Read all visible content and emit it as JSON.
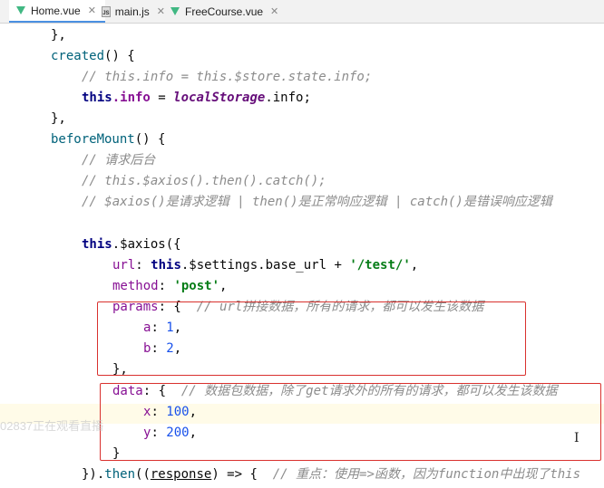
{
  "tabs": [
    {
      "name": "Home.vue",
      "icon": "vue-icon",
      "active": true
    },
    {
      "name": "main.js",
      "icon": "js-file-icon",
      "active": false
    },
    {
      "name": "FreeCourse.vue",
      "icon": "vue-icon",
      "active": false
    }
  ],
  "code": {
    "l1": "},",
    "l2_fn": "created",
    "l2_rest": "() {",
    "l3": "// this.info = this.$store.state.info;",
    "l4_this": "this",
    "l4_prop": ".info",
    "l4_eq": " = ",
    "l4_ls": "localStorage",
    "l4_rest": ".info;",
    "l5": "},",
    "l6_fn": "beforeMount",
    "l6_rest": "() {",
    "l7": "// 请求后台",
    "l8": "// this.$axios().then().catch();",
    "l9": "// $axios()是请求逻辑 | then()是正常响应逻辑 | catch()是错误响应逻辑",
    "l11_this": "this",
    "l11_rest": ".$axios({",
    "l12_key": "url",
    "l12_colon": ": ",
    "l12_this": "this",
    "l12_mid": ".$settings.base_url + ",
    "l12_str": "'/test/'",
    "l12_end": ",",
    "l13_key": "method",
    "l13_colon": ": ",
    "l13_str": "'post'",
    "l13_end": ",",
    "l14_key": "params",
    "l14_rest": ": {  ",
    "l14_cm": "// url拼接数据，所有的请求，都可以发生该数据",
    "l15_key": "a",
    "l15_colon": ": ",
    "l15_num": "1",
    "l15_end": ",",
    "l16_key": "b",
    "l16_colon": ": ",
    "l16_num": "2",
    "l16_end": ",",
    "l17": "},",
    "l18_key": "data",
    "l18_rest": ": {  ",
    "l18_cm": "// 数据包数据，除了get请求外的所有的请求，都可以发生该数据",
    "l19_key": "x",
    "l19_colon": ": ",
    "l19_num": "100",
    "l19_end": ",",
    "l20_key": "y",
    "l20_colon": ": ",
    "l20_num": "200",
    "l20_end": ",",
    "l21": "}",
    "l22_a": "}).",
    "l22_fn": "then",
    "l22_b": "((",
    "l22_param": "response",
    "l22_c": ") => {  ",
    "l22_cm": "// 重点：使用=>函数，因为function中出现了this"
  },
  "watermark": "02837正在观看直播"
}
